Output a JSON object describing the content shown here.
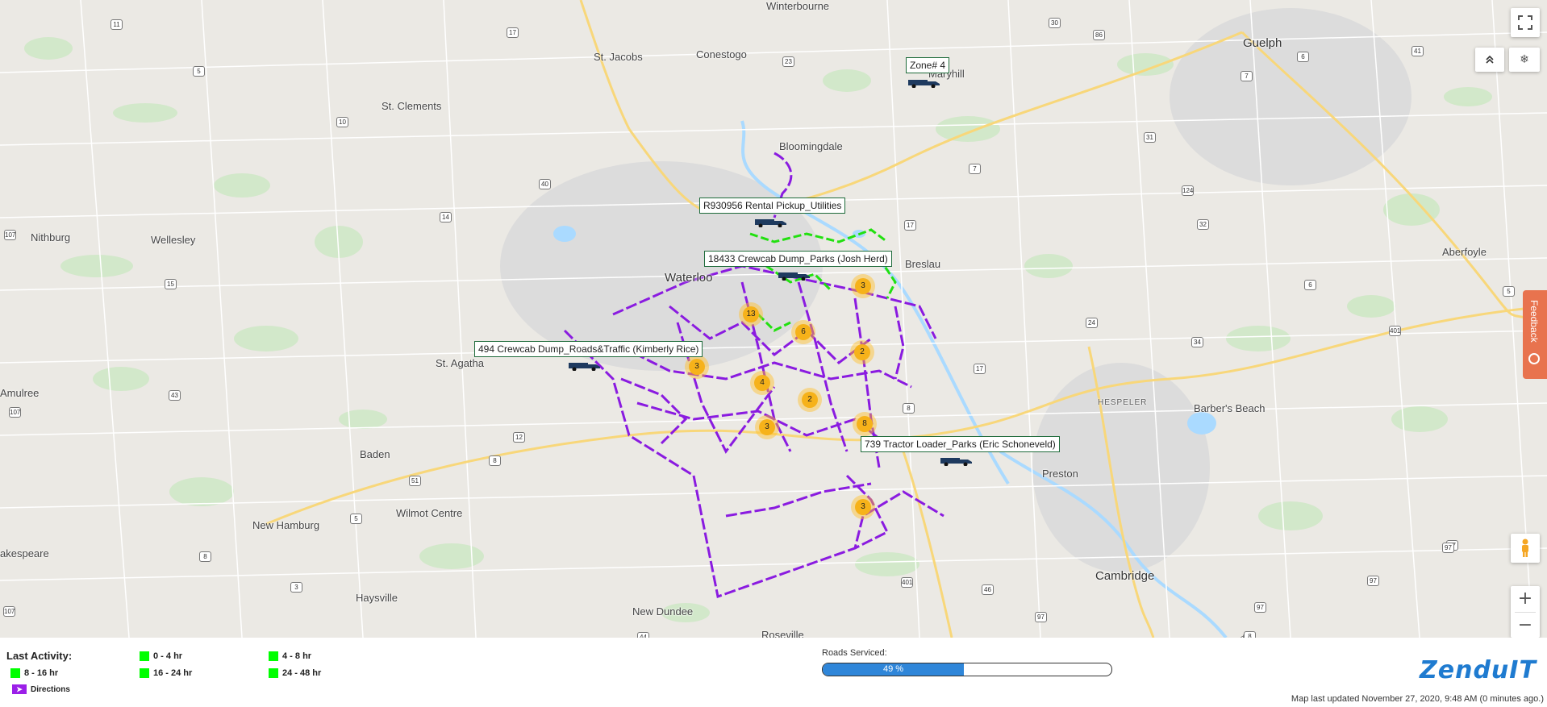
{
  "map": {
    "places": [
      {
        "id": "guelph",
        "text": "Guelph",
        "cls": "city"
      },
      {
        "id": "waterloo",
        "text": "Waterloo",
        "cls": "city"
      },
      {
        "id": "cambridge",
        "text": "Cambridge",
        "cls": "city"
      },
      {
        "id": "stjacobs",
        "text": "St. Jacobs",
        "cls": ""
      },
      {
        "id": "conestogo",
        "text": "Conestogo",
        "cls": ""
      },
      {
        "id": "winterbourne",
        "text": "Winterbourne",
        "cls": ""
      },
      {
        "id": "maryhill",
        "text": "Maryhill",
        "cls": ""
      },
      {
        "id": "stclements",
        "text": "St. Clements",
        "cls": ""
      },
      {
        "id": "bloomingdale",
        "text": "Bloomingdale",
        "cls": ""
      },
      {
        "id": "nithburg",
        "text": "Nithburg",
        "cls": ""
      },
      {
        "id": "wellesley",
        "text": "Wellesley",
        "cls": ""
      },
      {
        "id": "breslau",
        "text": "Breslau",
        "cls": ""
      },
      {
        "id": "aberfoyle",
        "text": "Aberfoyle",
        "cls": ""
      },
      {
        "id": "stagatha",
        "text": "St. Agatha",
        "cls": ""
      },
      {
        "id": "amulree",
        "text": "Amulree",
        "cls": ""
      },
      {
        "id": "hespeler",
        "text": "HESPELER",
        "cls": "small"
      },
      {
        "id": "barbersbeach",
        "text": "Barber's Beach",
        "cls": ""
      },
      {
        "id": "baden",
        "text": "Baden",
        "cls": ""
      },
      {
        "id": "wilmotcentre",
        "text": "Wilmot Centre",
        "cls": ""
      },
      {
        "id": "newhamburg",
        "text": "New Hamburg",
        "cls": ""
      },
      {
        "id": "preston",
        "text": "Preston",
        "cls": ""
      },
      {
        "id": "haysville",
        "text": "Haysville",
        "cls": ""
      },
      {
        "id": "newdundee",
        "text": "New Dundee",
        "cls": ""
      },
      {
        "id": "roseville",
        "text": "Roseville",
        "cls": ""
      },
      {
        "id": "akespeare",
        "text": "akespeare",
        "cls": ""
      }
    ],
    "vehicles": [
      {
        "id": "zone4",
        "label": "Zone# 4"
      },
      {
        "id": "r930956",
        "label": "R930956 Rental Pickup_Utilities"
      },
      {
        "id": "18433",
        "label": "18433 Crewcab Dump_Parks (Josh Herd)"
      },
      {
        "id": "494",
        "label": "494 Crewcab Dump_Roads&Traffic (Kimberly Rice)"
      },
      {
        "id": "739",
        "label": "739 Tractor Loader_Parks (Eric Schoneveld)"
      }
    ],
    "clusters": [
      "3",
      "13",
      "6",
      "2",
      "3",
      "4",
      "2",
      "3",
      "8",
      "3"
    ],
    "shields": [
      "11",
      "17",
      "23",
      "86",
      "30",
      "41",
      "7",
      "5",
      "10",
      "7",
      "31",
      "40",
      "124",
      "6",
      "17",
      "32",
      "14",
      "107",
      "15",
      "5",
      "107",
      "24",
      "34",
      "8",
      "43",
      "401",
      "17",
      "97",
      "12",
      "8",
      "8",
      "97",
      "12",
      "8",
      "51",
      "5",
      "6",
      "97",
      "97",
      "3",
      "46",
      "97",
      "401",
      "8",
      "8",
      "44",
      "107"
    ],
    "controls": {
      "fullscreen_icon": "fullscreen-icon",
      "collapse_icon": "chevron-up-icon",
      "snow_icon": "snowflake-icon",
      "pegman_icon": "pegman-icon",
      "zoom_in": "+",
      "zoom_out": "−"
    },
    "feedback": "Feedback"
  },
  "legend": {
    "title": "Last Activity:",
    "items": [
      {
        "label": "0 - 4 hr",
        "color": "#00ff00"
      },
      {
        "label": "4 - 8 hr",
        "color": "#00ff00"
      },
      {
        "label": "8 - 16 hr",
        "color": "#00ff00"
      },
      {
        "label": "16 - 24 hr",
        "color": "#00ff00"
      },
      {
        "label": "24 - 48 hr",
        "color": "#00ff00"
      }
    ],
    "directions": {
      "label": "Directions",
      "color": "#9b1fe8",
      "icon": "arrow-right-icon"
    }
  },
  "roads_serviced": {
    "label": "Roads Serviced:",
    "percent": 49,
    "text": "49 %"
  },
  "brand": {
    "logo": "ZenduIT",
    "color": "#1f7bd0"
  },
  "updated": "Map last updated November 27, 2020, 9:48 AM (0 minutes ago.)"
}
